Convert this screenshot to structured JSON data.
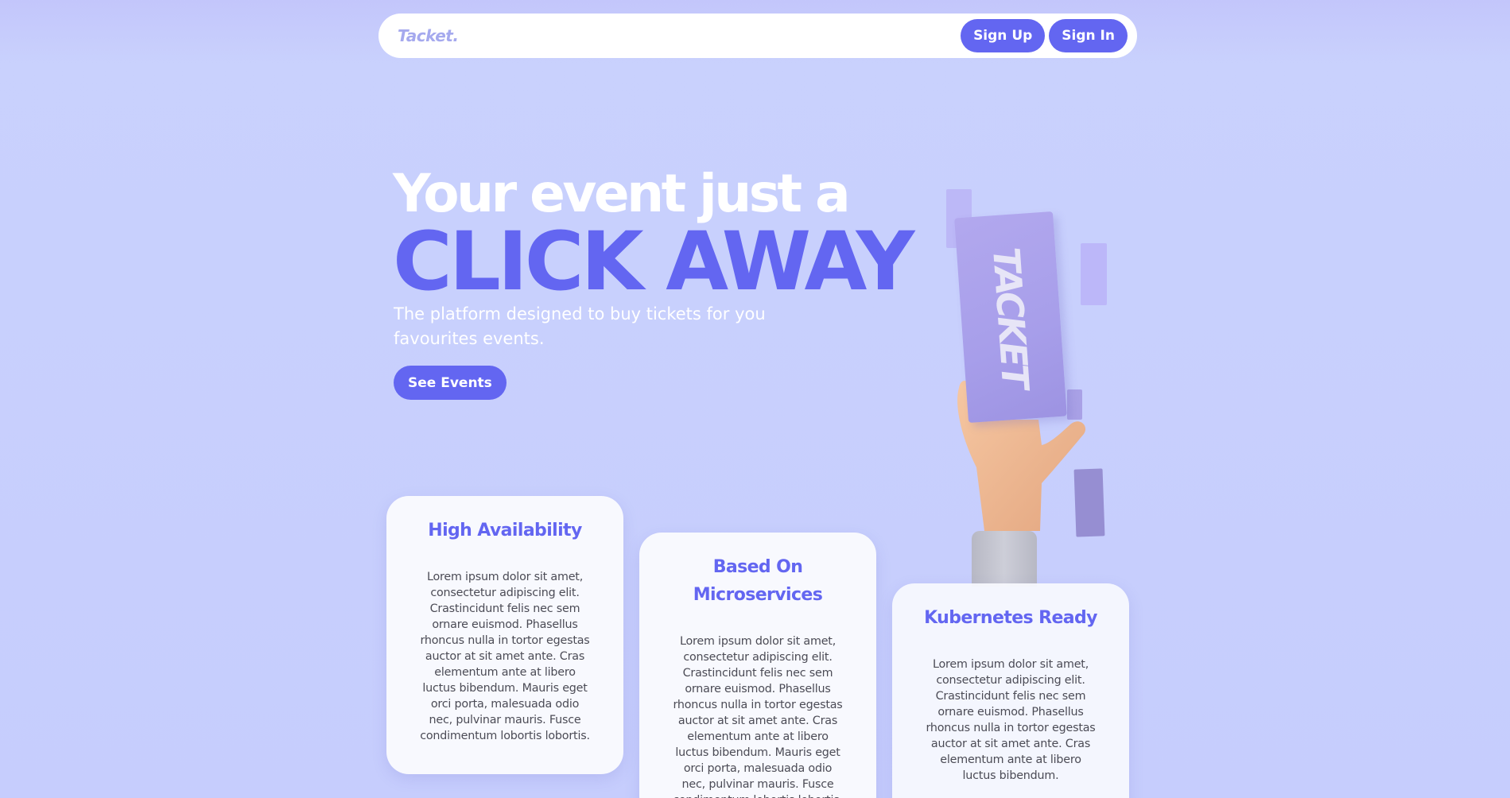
{
  "nav": {
    "logo": "Tacket.",
    "signup_label": "Sign Up",
    "signin_label": "Sign In"
  },
  "hero": {
    "line1": "Your event just a",
    "line2": "CLICK AWAY",
    "subtitle": "The platform designed to buy tickets for you favourites events.",
    "cta_label": "See Events"
  },
  "illustration": {
    "ticket_text": "TACKET"
  },
  "cards": [
    {
      "title": "High Availability",
      "body": "Lorem ipsum dolor sit amet, consectetur adipiscing elit. Crastincidunt felis nec sem ornare euismod. Phasellus rhoncus nulla in tortor egestas auctor at sit amet ante. Cras elementum ante at libero luctus bibendum. Mauris eget orci porta, malesuada odio nec, pulvinar mauris. Fusce condimentum lobortis lobortis."
    },
    {
      "title": "Based On Microservices",
      "body": "Lorem ipsum dolor sit amet, consectetur adipiscing elit. Crastincidunt felis nec sem ornare euismod. Phasellus rhoncus nulla in tortor egestas auctor at sit amet ante. Cras elementum ante at libero luctus bibendum. Mauris eget orci porta, malesuada odio nec, pulvinar mauris. Fusce condimentum lobortis lobortis."
    },
    {
      "title": "Kubernetes Ready",
      "body": "Lorem ipsum dolor sit amet, consectetur adipiscing elit. Crastincidunt felis nec sem ornare euismod. Phasellus rhoncus nulla in tortor egestas auctor at sit amet ante. Cras elementum ante at libero luctus bibendum."
    }
  ],
  "colors": {
    "accent": "#6366f1",
    "background": "#c6cdfd",
    "logo": "#a5a9ee",
    "card": "#f8f9fe"
  }
}
